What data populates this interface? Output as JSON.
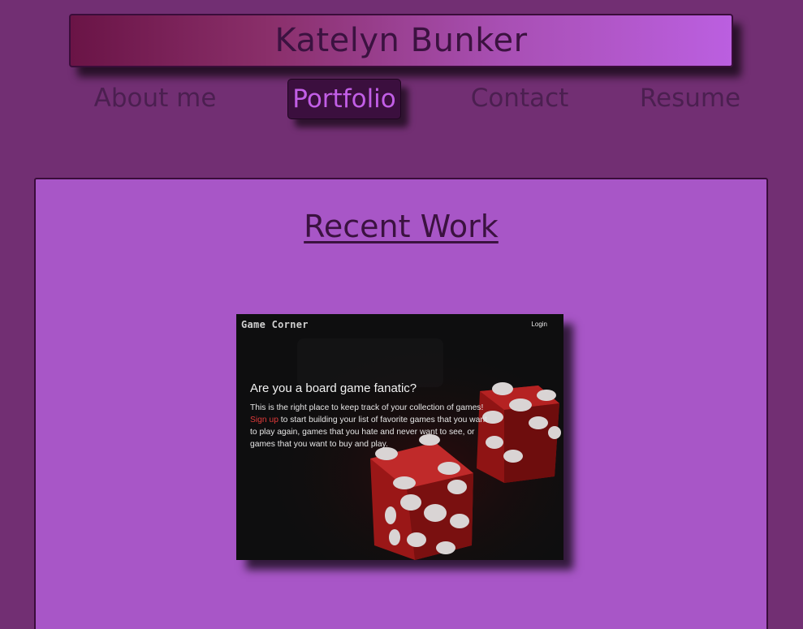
{
  "site": {
    "title": "Katelyn Bunker"
  },
  "nav": {
    "items": [
      {
        "label": "About me",
        "active": false
      },
      {
        "label": "Portfolio",
        "active": true
      },
      {
        "label": "Contact",
        "active": false
      },
      {
        "label": "Resume",
        "active": false
      }
    ]
  },
  "main": {
    "heading": "Recent Work",
    "project": {
      "logo": "Game Corner",
      "login": "Login",
      "headline": "Are you a board game fanatic?",
      "body_line1": "This is the right place to keep track of your collection of games!",
      "signup": "Sign up",
      "body_rest": " to start building your list of favorite games that you want to play again, games that you hate and never want to see, or games that you want to buy and play."
    }
  },
  "colors": {
    "page_bg": "#722f73",
    "content_bg": "#a856c7",
    "header_gradient_start": "#6a1446",
    "header_gradient_end": "#bb5fe0",
    "active_nav_bg": "#3b0f3e",
    "active_nav_text": "#c25ee6",
    "signup_accent": "#e03a3a"
  }
}
